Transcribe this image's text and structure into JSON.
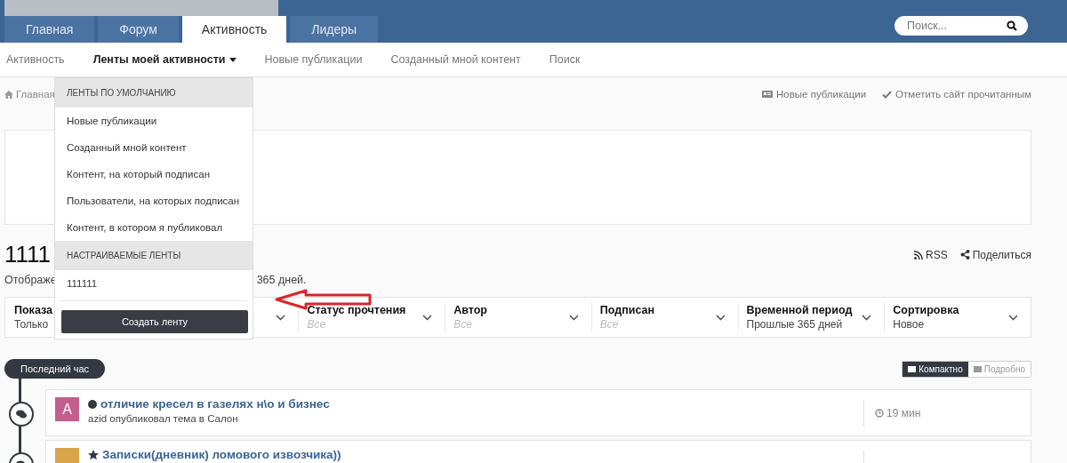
{
  "header": {
    "tabs": [
      {
        "label": "Главная",
        "selected": false
      },
      {
        "label": "Форум",
        "selected": false
      },
      {
        "label": "Активность",
        "selected": true
      },
      {
        "label": "Лидеры",
        "selected": false
      }
    ],
    "search": {
      "placeholder": "Поиск..."
    }
  },
  "subnav": [
    {
      "label": "Активность",
      "selected": false,
      "kind": "link"
    },
    {
      "label": "Ленты моей активности",
      "selected": true,
      "kind": "dropdown"
    },
    {
      "label": "Новые публикации",
      "selected": false,
      "kind": "link"
    },
    {
      "label": "Созданный мной контент",
      "selected": false,
      "kind": "link"
    },
    {
      "label": "Поиск",
      "selected": false,
      "kind": "link"
    }
  ],
  "breadcrumb": "Главная",
  "page_actions": [
    {
      "label": "Новые публикации",
      "kind": "news"
    },
    {
      "label": "Отметить сайт прочитанным",
      "kind": "check"
    }
  ],
  "page_title": "1111",
  "subtitle_start": "Отображе",
  "subtitle_end": "365 дней.",
  "feed_links": [
    {
      "label": "RSS",
      "kind": "rss"
    },
    {
      "label": "Поделиться",
      "kind": "share"
    }
  ],
  "filters": [
    {
      "label": "Показа",
      "value": "Только",
      "placeholder": false
    },
    {
      "label": "Статус прочтения",
      "value": "Все",
      "placeholder": true
    },
    {
      "label": "Автор",
      "value": "Все",
      "placeholder": true
    },
    {
      "label": "Подписан",
      "value": "Все",
      "placeholder": true
    },
    {
      "label": "Временной период",
      "value": "Прошлые 365 дней",
      "placeholder": false
    },
    {
      "label": "Сортировка",
      "value": "Новое",
      "placeholder": false
    }
  ],
  "view_toggle": [
    {
      "label": "Компактно",
      "selected": true
    },
    {
      "label": "Подробно",
      "selected": false
    }
  ],
  "timeline": {
    "label": "Последний час",
    "items": [
      {
        "title": "отличие кресел в газелях н\\о и бизнес",
        "kind": "unread",
        "avatar_letter": "A",
        "meta": "azid опубликовал тема в Салон",
        "time": "19 мин"
      },
      {
        "title": "Записки(дневник) ломового извозчика))",
        "kind": "featured"
      }
    ]
  },
  "dropdown": {
    "sections": [
      {
        "heading": "ЛЕНТЫ ПО УМОЛЧАНИЮ",
        "items": [
          "Новые публикации",
          "Созданный мной контент",
          "Контент, на который подписан",
          "Пользователи, на которых подписан",
          "Контент, в котором я публиковал"
        ]
      },
      {
        "heading": "НАСТРАИВАЕМЫЕ ЛЕНТЫ",
        "items": [
          "111111"
        ]
      }
    ],
    "button": "Создать ленту"
  }
}
